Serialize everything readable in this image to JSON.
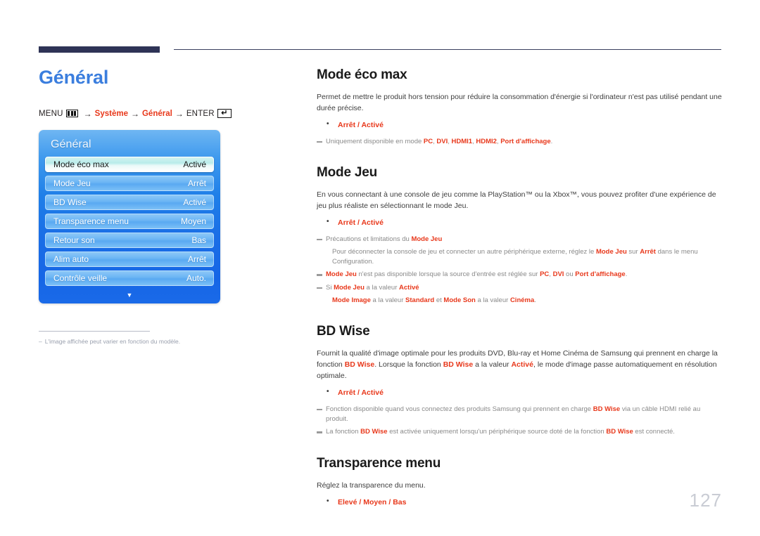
{
  "page": {
    "title": "Général",
    "number": "127"
  },
  "breadcrumb": {
    "menu_label": "MENU",
    "menu_icon": "menu-bars-icon",
    "arrow": "→",
    "step1": "Système",
    "step2": "Général",
    "enter_label": "ENTER",
    "enter_icon": "enter-return-icon",
    "enter_glyph": "↵"
  },
  "osd": {
    "title": "Général",
    "scroll_down_glyph": "▼",
    "rows": [
      {
        "label": "Mode éco max",
        "value": "Activé",
        "selected": true
      },
      {
        "label": "Mode Jeu",
        "value": "Arrêt",
        "selected": false
      },
      {
        "label": "BD Wise",
        "value": "Activé",
        "selected": false
      },
      {
        "label": "Transparence menu",
        "value": "Moyen",
        "selected": false
      },
      {
        "label": "Retour son",
        "value": "Bas",
        "selected": false
      },
      {
        "label": "Alim auto",
        "value": "Arrêt",
        "selected": false
      },
      {
        "label": "Contrôle veille",
        "value": "Auto.",
        "selected": false
      }
    ]
  },
  "left_footnote": {
    "dash": "–",
    "text": "L'image affichée peut varier en fonction du modèle."
  },
  "sections": {
    "mode_eco_max": {
      "title": "Mode éco max",
      "body": "Permet de mettre le produit hors tension pour réduire la consommation d'énergie si l'ordinateur n'est pas utilisé pendant une durée précise.",
      "option": "Arrêt / Activé",
      "note_prefix": "Uniquement disponible en mode ",
      "note_bold1": "PC",
      "note_mid1": ", ",
      "note_bold2": "DVI",
      "note_mid2": ", ",
      "note_bold3": "HDMI1",
      "note_mid3": ", ",
      "note_bold4": "HDMI2",
      "note_mid4": ", ",
      "note_bold5": "Port d'affichage",
      "note_suffix": "."
    },
    "mode_jeu": {
      "title": "Mode Jeu",
      "body": "En vous connectant à une console de jeu comme la PlayStation™ ou la Xbox™, vous pouvez profiter d'une expérience de jeu plus réaliste en sélectionnant le mode Jeu.",
      "option": "Arrêt / Activé",
      "note1_pre": "Précautions et limitations du ",
      "note1_bold": "Mode Jeu",
      "note1_sub_pre": "Pour déconnecter la console de jeu et connecter un autre périphérique externe, réglez le ",
      "note1_sub_bold1": "Mode Jeu",
      "note1_sub_mid": " sur ",
      "note1_sub_bold2": "Arrêt",
      "note1_sub_post": " dans le menu Configuration.",
      "note2_bold1": "Mode Jeu",
      "note2_mid1": " n'est pas disponible lorsque la source d'entrée est réglée sur ",
      "note2_bold2": "PC",
      "note2_mid2": ", ",
      "note2_bold3": "DVI",
      "note2_mid3": " ou ",
      "note2_bold4": "Port d'affichage",
      "note2_post": ".",
      "note3_pre": "Si ",
      "note3_bold1": "Mode Jeu",
      "note3_mid": " a la valeur ",
      "note3_bold2": "Activé",
      "note3_sub_bold1": "Mode Image",
      "note3_sub_mid1": " a la valeur ",
      "note3_sub_bold2": "Standard",
      "note3_sub_mid2": " et ",
      "note3_sub_bold3": "Mode Son",
      "note3_sub_mid3": " a la valeur ",
      "note3_sub_bold4": "Cinéma",
      "note3_sub_post": "."
    },
    "bd_wise": {
      "title": "BD Wise",
      "body_pre": "Fournit la qualité d'image optimale pour les produits DVD, Blu-ray et Home Cinéma de Samsung qui prennent en charge la fonction ",
      "body_bold1": "BD Wise",
      "body_mid1": ". Lorsque la fonction ",
      "body_bold2": "BD Wise",
      "body_mid2": " a la valeur ",
      "body_bold3": "Activé",
      "body_post": ", le mode d'image passe automatiquement en résolution optimale.",
      "option": "Arrêt / Activé",
      "note1_pre": "Fonction disponible quand vous connectez des produits Samsung qui prennent en charge ",
      "note1_bold": "BD Wise",
      "note1_post": " via un câble HDMI relié au produit.",
      "note2_pre": "La fonction ",
      "note2_bold1": "BD Wise",
      "note2_mid": " est activée uniquement lorsqu'un périphérique source doté de la fonction ",
      "note2_bold2": "BD Wise",
      "note2_post": " est connecté."
    },
    "transparence_menu": {
      "title": "Transparence menu",
      "body": "Réglez la transparence du menu.",
      "option": "Elevé / Moyen / Bas"
    }
  },
  "colors": {
    "title_blue": "#3b7ede",
    "accent_red": "#e8381b",
    "rule_navy": "#2e3356",
    "osd_blue": "#1a6ee6",
    "page_number_gray": "#c9ccd4"
  }
}
